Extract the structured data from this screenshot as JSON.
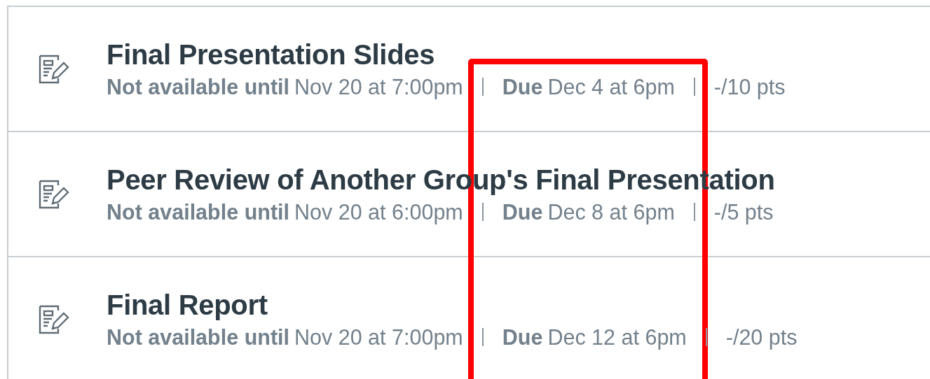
{
  "assignments": [
    {
      "title": "Final Presentation Slides",
      "availability_label": "Not available until",
      "availability_date": "Nov 20 at 7:00pm",
      "due_label": "Due",
      "due_date": "Dec 4 at 6pm",
      "points": "-/10 pts"
    },
    {
      "title": "Peer Review of Another Group's Final Presentation",
      "availability_label": "Not available until",
      "availability_date": "Nov 20 at 6:00pm",
      "due_label": "Due",
      "due_date": "Dec 8 at 6pm",
      "points": "-/5 pts"
    },
    {
      "title": "Final Report",
      "availability_label": "Not available until",
      "availability_date": "Nov 20 at 7:00pm",
      "due_label": "Due",
      "due_date": "Dec 12 at 6pm",
      "points": "-/20 pts"
    }
  ],
  "highlight_frame": true
}
